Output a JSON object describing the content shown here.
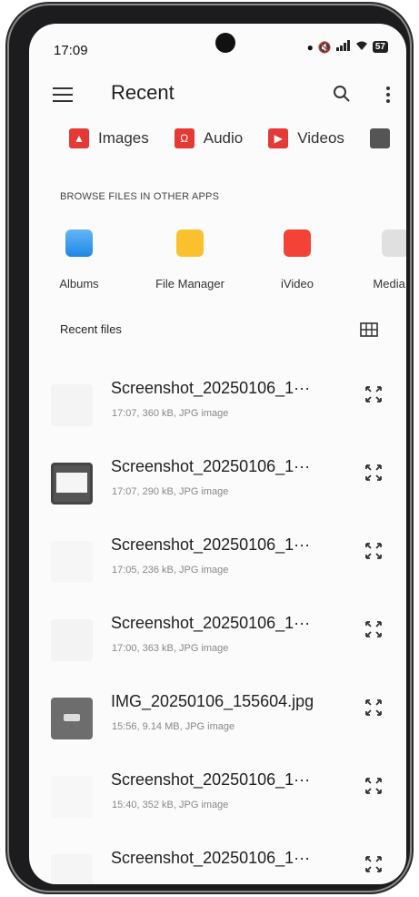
{
  "status_bar": {
    "time": "17:09",
    "battery": "57"
  },
  "app_bar": {
    "title": "Recent"
  },
  "chips": [
    {
      "label": "Images",
      "color": "#e53935"
    },
    {
      "label": "Audio",
      "color": "#e53935"
    },
    {
      "label": "Videos",
      "color": "#e53935"
    }
  ],
  "browse_section": {
    "heading": "BROWSE FILES IN OTHER APPS",
    "apps": [
      {
        "label": "Albums",
        "color": "#42a5f5"
      },
      {
        "label": "File Manager",
        "color": "#fbc02d"
      },
      {
        "label": "iVideo",
        "color": "#f44336"
      },
      {
        "label": "Media pi",
        "color": "#e0e0e0"
      }
    ]
  },
  "recent_files": {
    "heading": "Recent files",
    "items": [
      {
        "name": "Screenshot_20250106_1···",
        "meta": "17:07, 360 kB, JPG image"
      },
      {
        "name": "Screenshot_20250106_1···",
        "meta": "17:07, 290 kB, JPG image"
      },
      {
        "name": "Screenshot_20250106_1···",
        "meta": "17:05, 236 kB, JPG image"
      },
      {
        "name": "Screenshot_20250106_1···",
        "meta": "17:00, 363 kB, JPG image"
      },
      {
        "name": "IMG_20250106_155604.jpg",
        "meta": "15:56, 9.14 MB, JPG image"
      },
      {
        "name": "Screenshot_20250106_1···",
        "meta": "15:40, 352 kB, JPG image"
      },
      {
        "name": "Screenshot_20250106_1···",
        "meta": ""
      }
    ]
  }
}
